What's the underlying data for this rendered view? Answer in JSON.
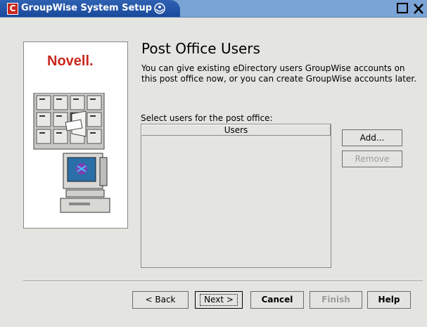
{
  "window": {
    "title": "GroupWise System Setup",
    "icon_letter": "C"
  },
  "sidebar": {
    "logo_text": "Novell."
  },
  "page": {
    "heading": "Post Office Users",
    "description": "You can give existing eDirectory users GroupWise accounts on this post office now, or you can create GroupWise accounts later.",
    "select_label": "Select users for the post office:",
    "list_header": "Users"
  },
  "side_buttons": {
    "add_label": "Add...",
    "remove_label": "Remove"
  },
  "footer": {
    "back_label": "< Back",
    "next_label": "Next >",
    "cancel_label": "Cancel",
    "finish_label": "Finish",
    "help_label": "Help"
  },
  "colors": {
    "title_bar_blue": "#2f62b3",
    "title_bar_light": "#7aa3d6",
    "novell_red": "#c8281e",
    "dialog_bg": "#e4e4e0",
    "disabled_text": "#9c9c98"
  }
}
